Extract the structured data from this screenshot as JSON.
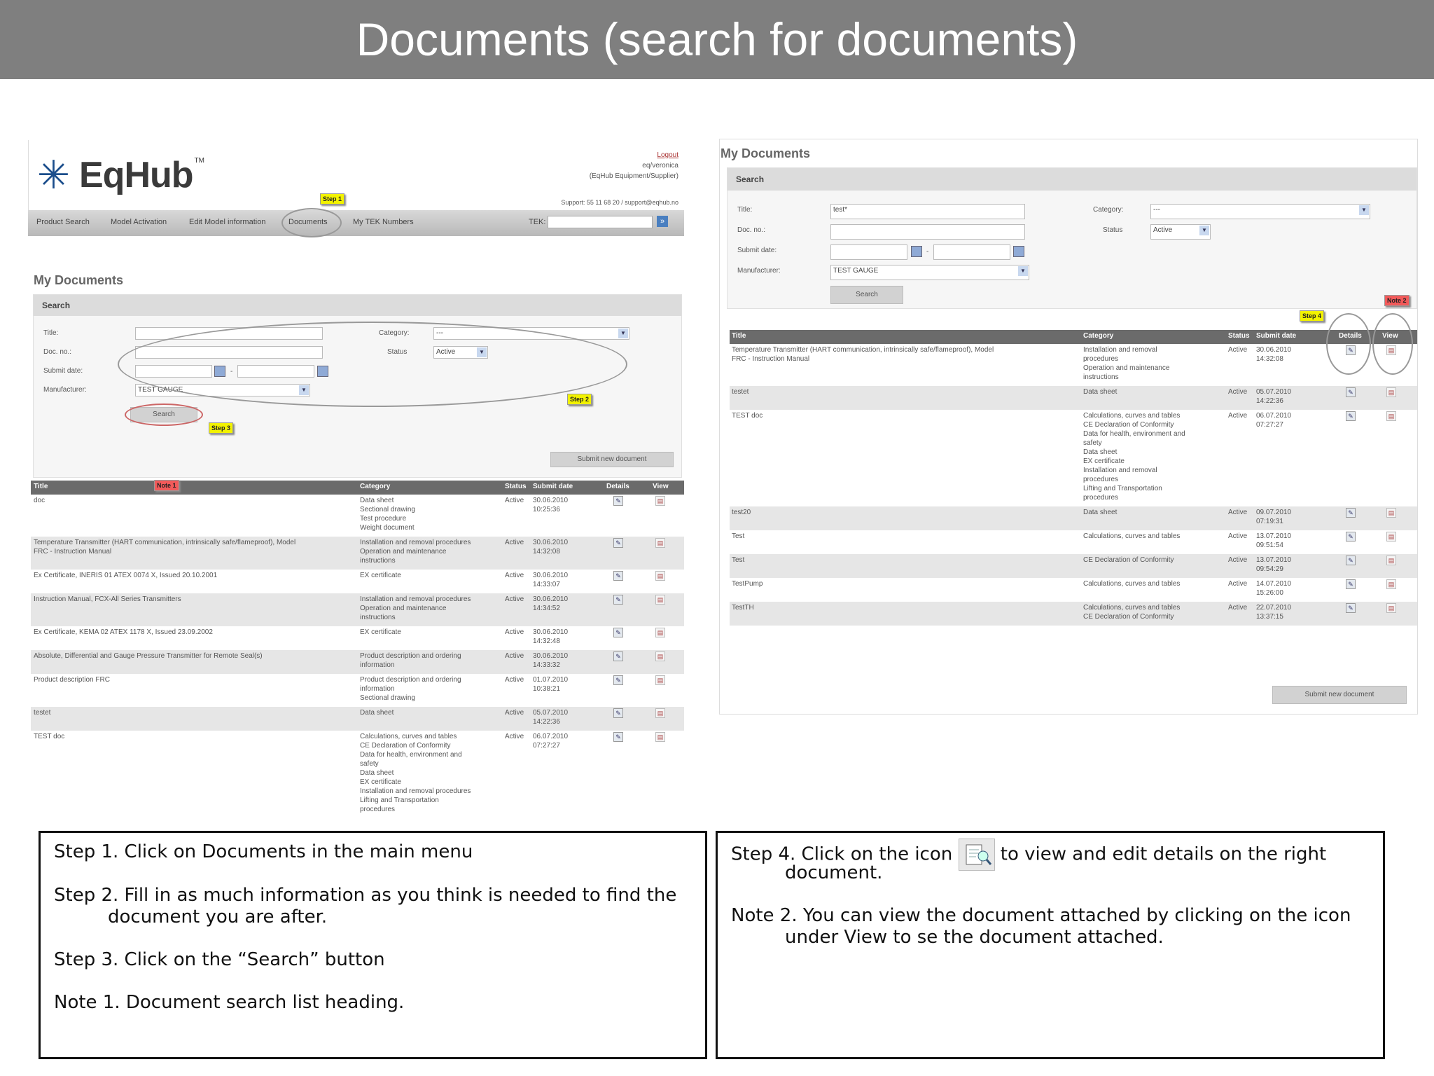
{
  "banner": {
    "title": "Documents (search for documents)"
  },
  "left": {
    "logo_text": "EqHub",
    "logo_tm": "TM",
    "header_links": [
      "Logout",
      "eq/veronica",
      "(EqHub Equipment/Supplier)"
    ],
    "support": "Support: 55 11 68 20 / support@eqhub.no",
    "nav": [
      "Product Search",
      "Model Activation",
      "Edit Model information",
      "Documents",
      "My TEK Numbers"
    ],
    "tek_label": "TEK:",
    "section_title": "My Documents",
    "search_title": "Search",
    "labels": {
      "title": "Title:",
      "doc_no": "Doc. no.:",
      "submit_date": "Submit date:",
      "manufacturer": "Manufacturer:",
      "category": "Category:",
      "status": "Status"
    },
    "values": {
      "manufacturer": "TEST GAUGE",
      "category": "---",
      "status": "Active"
    },
    "search_button": "Search",
    "submit_button": "Submit new document",
    "tags": {
      "step1": "Step 1",
      "step2": "Step 2",
      "step3": "Step 3",
      "note1": "Note 1"
    },
    "columns": [
      "Title",
      "Category",
      "Status",
      "Submit date",
      "Details",
      "View"
    ],
    "rows": [
      {
        "title": "doc",
        "category": "Data sheet\nSectional drawing\nTest procedure\nWeight document",
        "status": "Active",
        "date": "30.06.2010\n10:25:36"
      },
      {
        "title": "Temperature Transmitter (HART communication, intrinsically safe/flameproof), Model\nFRC - Instruction Manual",
        "category": "Installation and removal procedures\nOperation and maintenance\ninstructions",
        "status": "Active",
        "date": "30.06.2010\n14:32:08"
      },
      {
        "title": "Ex Certificate, INERIS 01 ATEX 0074 X, Issued 20.10.2001",
        "category": "EX certificate",
        "status": "Active",
        "date": "30.06.2010\n14:33:07"
      },
      {
        "title": "Instruction Manual, FCX-All Series Transmitters",
        "category": "Installation and removal procedures\nOperation and maintenance\ninstructions",
        "status": "Active",
        "date": "30.06.2010\n14:34:52"
      },
      {
        "title": "Ex Certificate, KEMA 02 ATEX 1178 X, Issued 23.09.2002",
        "category": "EX certificate",
        "status": "Active",
        "date": "30.06.2010\n14:32:48"
      },
      {
        "title": "Absolute, Differential and Gauge Pressure Transmitter for Remote Seal(s)",
        "category": "Product description and ordering\ninformation",
        "status": "Active",
        "date": "30.06.2010\n14:33:32"
      },
      {
        "title": "Product description FRC",
        "category": "Product description and ordering\ninformation\nSectional drawing",
        "status": "Active",
        "date": "01.07.2010\n10:38:21"
      },
      {
        "title": "testet",
        "category": "Data sheet",
        "status": "Active",
        "date": "05.07.2010\n14:22:36"
      },
      {
        "title": "TEST doc",
        "category": "Calculations, curves and tables\nCE Declaration of Conformity\nData for health, environment and\nsafety\nData sheet\nEX certificate\nInstallation and removal procedures\nLifting and Transportation\nprocedures",
        "status": "Active",
        "date": "06.07.2010\n07:27:27"
      }
    ]
  },
  "right": {
    "section_title": "My Documents",
    "search_title": "Search",
    "labels": {
      "title": "Title:",
      "doc_no": "Doc. no.:",
      "submit_date": "Submit date:",
      "manufacturer": "Manufacturer:",
      "category": "Category:",
      "status": "Status"
    },
    "values": {
      "title": "test*",
      "manufacturer": "TEST GAUGE",
      "category": "---",
      "status": "Active"
    },
    "search_button": "Search",
    "submit_button": "Submit new document",
    "tags": {
      "step4": "Step 4",
      "note2": "Note 2"
    },
    "columns": [
      "Title",
      "Category",
      "Status",
      "Submit date",
      "Details",
      "View"
    ],
    "rows": [
      {
        "title": "Temperature Transmitter (HART communication, intrinsically safe/flameproof), Model\nFRC - Instruction Manual",
        "category": "Installation and removal\nprocedures\nOperation and maintenance\ninstructions",
        "status": "Active",
        "date": "30.06.2010\n14:32:08"
      },
      {
        "title": "testet",
        "category": "Data sheet",
        "status": "Active",
        "date": "05.07.2010\n14:22:36"
      },
      {
        "title": "TEST doc",
        "category": "Calculations, curves and tables\nCE Declaration of Conformity\nData for health, environment and\nsafety\nData sheet\nEX certificate\nInstallation and removal\nprocedures\nLifting and Transportation\nprocedures",
        "status": "Active",
        "date": "06.07.2010\n07:27:27"
      },
      {
        "title": "test20",
        "category": "Data sheet",
        "status": "Active",
        "date": "09.07.2010\n07:19:31"
      },
      {
        "title": "Test",
        "category": "Calculations, curves and tables",
        "status": "Active",
        "date": "13.07.2010\n09:51:54"
      },
      {
        "title": "Test",
        "category": "CE Declaration of Conformity",
        "status": "Active",
        "date": "13.07.2010\n09:54:29"
      },
      {
        "title": "TestPump",
        "category": "Calculations, curves and tables",
        "status": "Active",
        "date": "14.07.2010\n15:26:00"
      },
      {
        "title": "TestTH",
        "category": "Calculations, curves and tables\nCE Declaration of Conformity",
        "status": "Active",
        "date": "22.07.2010\n13:37:15"
      }
    ]
  },
  "box_left": {
    "step1": "Step 1. Click on Documents in the main menu",
    "step2_a": "Step 2. Fill in as much information as you think is needed to find the",
    "step2_b": "document you are after.",
    "step3": "Step 3. Click on the “Search” button",
    "note1": "Note 1. Document search list heading."
  },
  "box_right": {
    "step4_a": "Step 4. Click on the icon",
    "step4_b": "to view and edit details on the right",
    "step4_c": "document.",
    "note2_a": "Note 2. You can view the document attached by clicking on the icon",
    "note2_b": "under View to se the document attached."
  }
}
